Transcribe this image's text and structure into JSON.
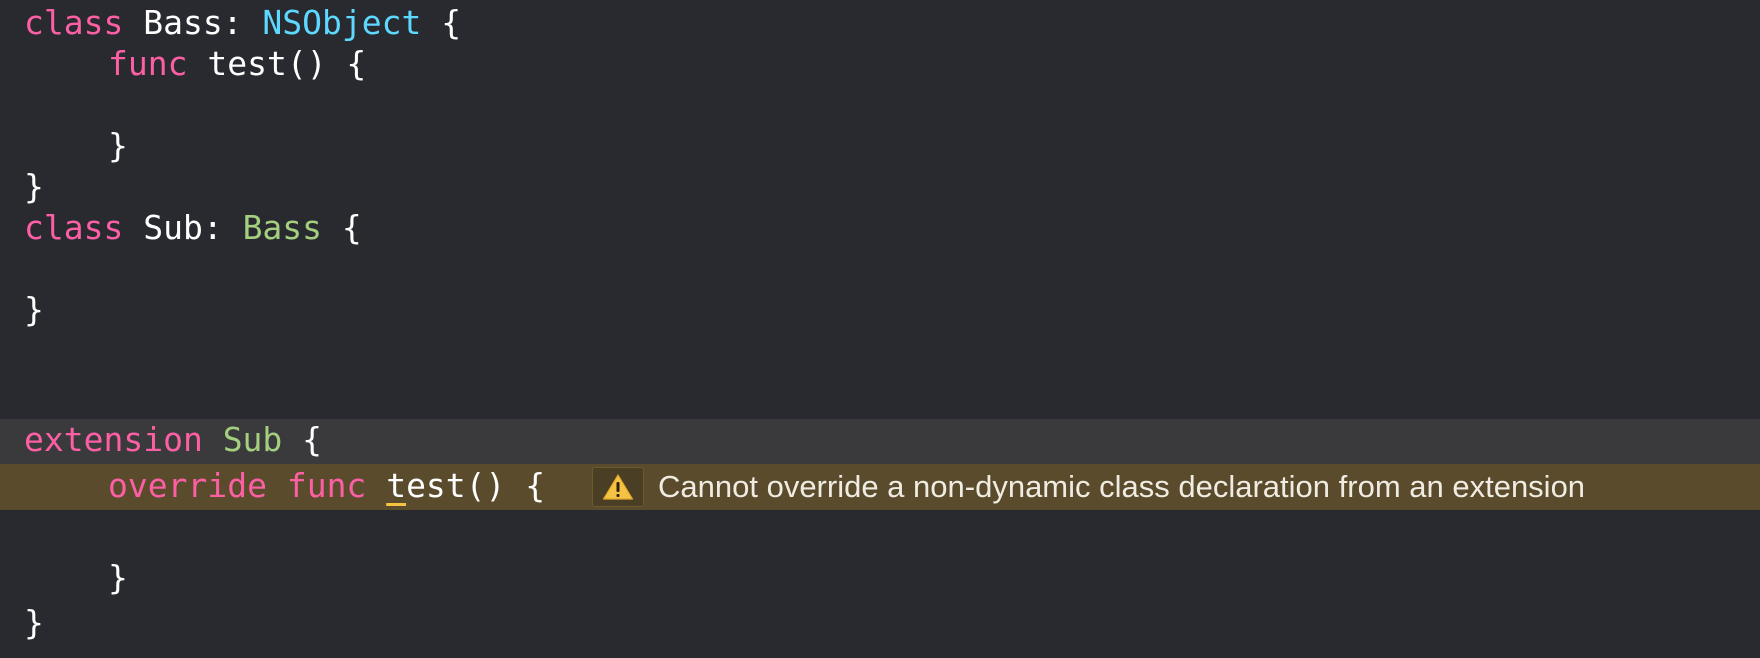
{
  "editor": {
    "lines": [
      {
        "tokens": [
          "class",
          " Bass: ",
          "NSObject",
          " {"
        ]
      },
      {
        "tokens": [
          "func",
          " test() {"
        ]
      },
      {
        "tokens": [
          ""
        ]
      },
      {
        "tokens": [
          "}"
        ]
      },
      {
        "tokens": [
          "}"
        ]
      },
      {
        "tokens": [
          "class",
          " Sub: ",
          "Bass",
          " {"
        ]
      },
      {
        "tokens": [
          ""
        ]
      },
      {
        "tokens": [
          "}"
        ]
      },
      {
        "tokens": [
          ""
        ]
      },
      {
        "tokens": [
          "extension",
          " ",
          "Sub",
          " {"
        ]
      },
      {
        "tokens": [
          "override",
          " ",
          "func",
          " ",
          "t",
          "est() {"
        ]
      },
      {
        "tokens": [
          ""
        ]
      },
      {
        "tokens": [
          "}"
        ]
      },
      {
        "tokens": [
          "}"
        ]
      }
    ]
  },
  "issue": {
    "severity": "warning",
    "icon": "warning-triangle-icon",
    "message": "Cannot override a non-dynamic class declaration from an extension"
  },
  "colors": {
    "background": "#292a30",
    "current_line": "#3a3a3d",
    "warning_line": "#594b2b",
    "keyword": "#fc5fa3",
    "system_type": "#5dd8ff",
    "project_type": "#a3cf7f",
    "plain_text": "#ffffff",
    "warning_accent": "#f6c244"
  }
}
